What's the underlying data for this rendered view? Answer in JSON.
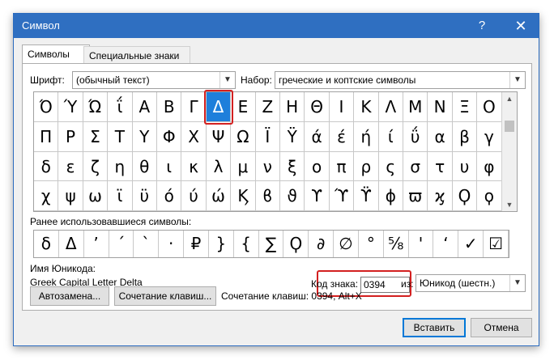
{
  "window": {
    "title": "Символ",
    "help": "?",
    "close": "✕"
  },
  "tabs": [
    {
      "label": "Символы"
    },
    {
      "label": "Специальные знаки"
    }
  ],
  "font": {
    "label": "Шрифт:",
    "value": "(обычный текст)"
  },
  "subset": {
    "label": "Набор:",
    "value": "греческие и коптские символы"
  },
  "grid": {
    "rows": [
      [
        "Ό",
        "Ύ",
        "Ώ",
        "ΐ",
        "Α",
        "Β",
        "Γ",
        "Δ",
        "Ε",
        "Ζ",
        "Η",
        "Θ",
        "Ι",
        "Κ",
        "Λ",
        "Μ",
        "Ν",
        "Ξ",
        "Ο"
      ],
      [
        "Π",
        "Ρ",
        "Σ",
        "Τ",
        "Υ",
        "Φ",
        "Χ",
        "Ψ",
        "Ω",
        "Ϊ",
        "Ϋ",
        "ά",
        "έ",
        "ή",
        "ί",
        "ΰ",
        "α",
        "β",
        "γ"
      ],
      [
        "δ",
        "ε",
        "ζ",
        "η",
        "θ",
        "ι",
        "κ",
        "λ",
        "μ",
        "ν",
        "ξ",
        "ο",
        "π",
        "ρ",
        "ς",
        "σ",
        "τ",
        "υ",
        "φ"
      ],
      [
        "χ",
        "ψ",
        "ω",
        "ϊ",
        "ϋ",
        "ό",
        "ύ",
        "ώ",
        "Ϗ",
        "ϐ",
        "ϑ",
        "ϒ",
        "ϓ",
        "ϔ",
        "ϕ",
        "ϖ",
        "ϗ",
        "Ϙ",
        "ϙ"
      ]
    ],
    "selected": "Δ"
  },
  "recent": {
    "label": "Ранее использовавшиеся символы:",
    "symbols": [
      "δ",
      "Δ",
      "’",
      "´",
      "`",
      "·",
      "₽",
      "}",
      "{",
      "∑",
      "Ϙ",
      "∂",
      "∅",
      "°",
      "⅝",
      "'",
      "‘",
      "✓",
      "☑"
    ]
  },
  "unicode_name": {
    "label": "Имя Юникода:",
    "value": "Greek Capital Letter Delta"
  },
  "code": {
    "label": "Код знака:",
    "value": "0394"
  },
  "from": {
    "label": "из:",
    "value": "Юникод (шестн.)"
  },
  "buttons": {
    "autocorrect": "Автозамена...",
    "shortcut_key": "Сочетание клавиш...",
    "insert": "Вставить",
    "cancel": "Отмена"
  },
  "shortcut_info": "Сочетание клавиш: 0394, Alt+X"
}
